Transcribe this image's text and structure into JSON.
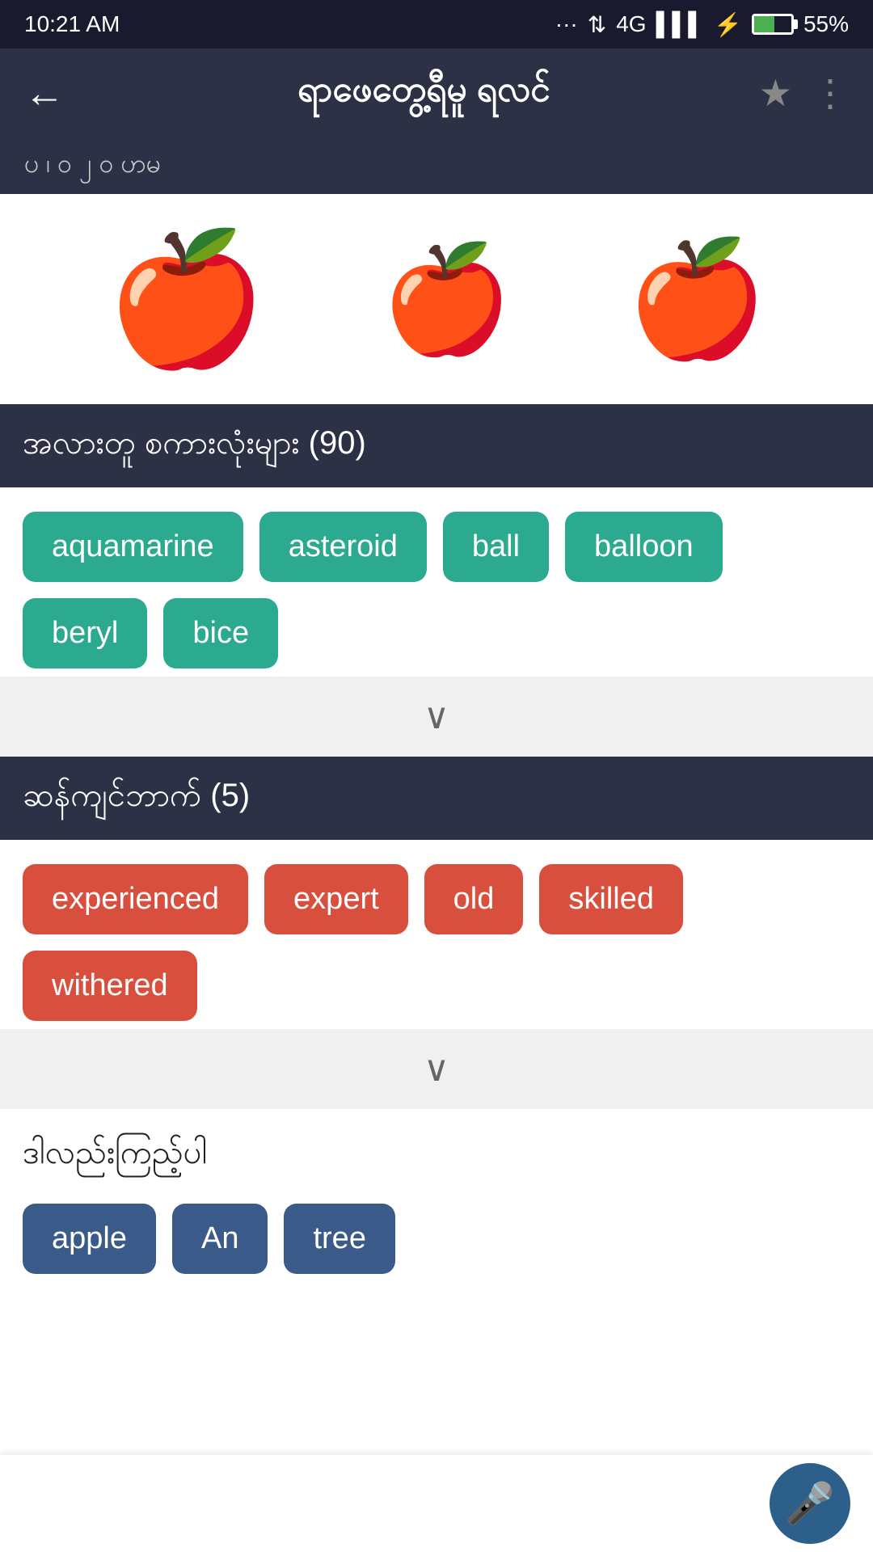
{
  "statusBar": {
    "time": "10:21 AM",
    "batteryPercent": "55%",
    "network": "4G"
  },
  "topNav": {
    "backLabel": "←",
    "title": "ရာဖေတွေ့ရီမူ ရလင်",
    "starLabel": "★",
    "moreLabel": "⋮"
  },
  "subNav": {
    "text": "ပ  ၊  ဝ  ၂  ၀          ဟမ"
  },
  "appleIcons": [
    "🍎",
    "🍎",
    "🍎"
  ],
  "relatedSection": {
    "title": "အလားတူ စကားလုံးများ (90)",
    "tags": [
      "aquamarine",
      "asteroid",
      "ball",
      "balloon",
      "beryl",
      "bice"
    ]
  },
  "synonymSection": {
    "title": "ဆန်ကျင်ဘာက် (5)",
    "tags": [
      "experienced",
      "expert",
      "old",
      "skilled",
      "withered"
    ]
  },
  "bottomSection": {
    "title": "ဒါလည်းကြည့်ပါ",
    "tags": [
      "apple",
      "An",
      "tree"
    ]
  },
  "ui": {
    "expandChevron": "∨",
    "micLabel": "🎤"
  }
}
